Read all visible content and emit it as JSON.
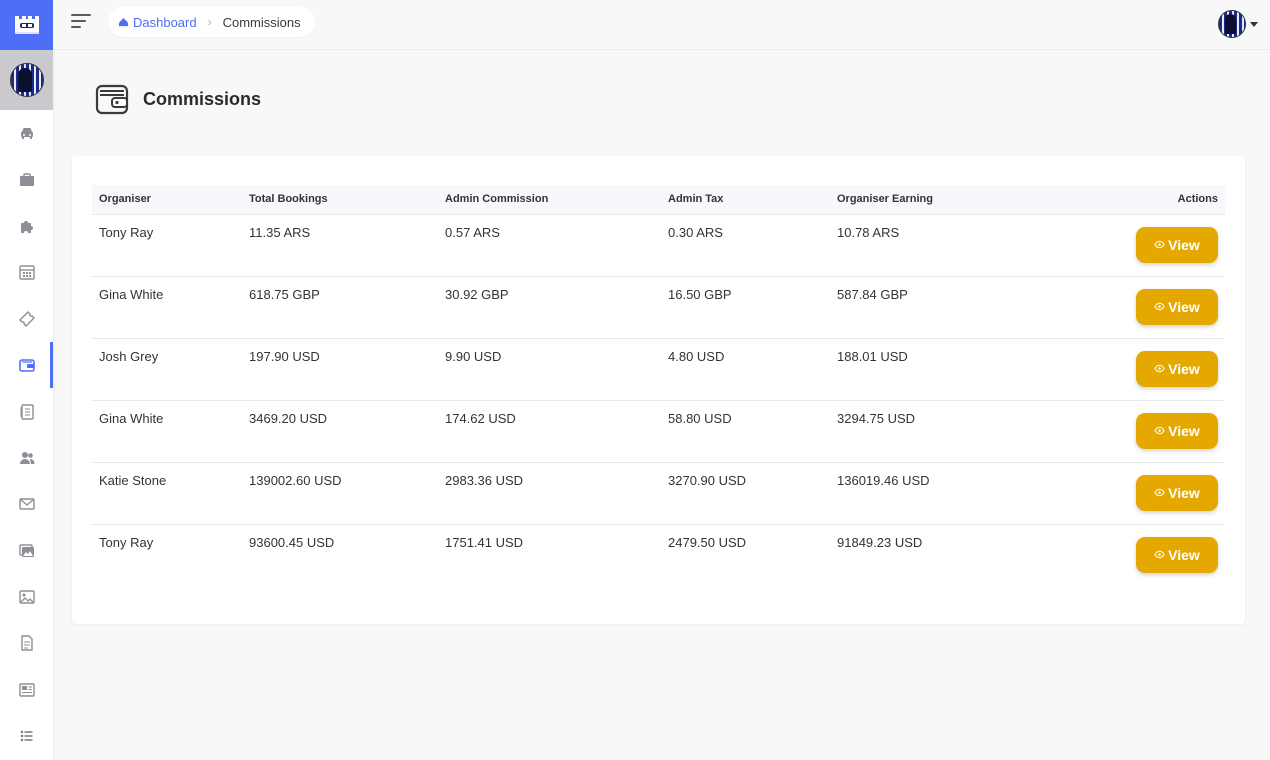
{
  "breadcrumb": {
    "home": "Dashboard",
    "current": "Commissions"
  },
  "page": {
    "title": "Commissions"
  },
  "table": {
    "headers": {
      "organiser": "Organiser",
      "total_bookings": "Total Bookings",
      "admin_commission": "Admin Commission",
      "admin_tax": "Admin Tax",
      "organiser_earning": "Organiser Earning",
      "actions": "Actions"
    },
    "view_label": "View",
    "rows": [
      {
        "organiser": "Tony Ray",
        "total_bookings": "11.35 ARS",
        "admin_commission": "0.57 ARS",
        "admin_tax": "0.30 ARS",
        "organiser_earning": "10.78 ARS"
      },
      {
        "organiser": "Gina White",
        "total_bookings": "618.75 GBP",
        "admin_commission": "30.92 GBP",
        "admin_tax": "16.50 GBP",
        "organiser_earning": "587.84 GBP"
      },
      {
        "organiser": "Josh Grey",
        "total_bookings": "197.90 USD",
        "admin_commission": "9.90 USD",
        "admin_tax": "4.80 USD",
        "organiser_earning": "188.01 USD"
      },
      {
        "organiser": "Gina White",
        "total_bookings": "3469.20 USD",
        "admin_commission": "174.62 USD",
        "admin_tax": "58.80 USD",
        "organiser_earning": "3294.75 USD"
      },
      {
        "organiser": "Katie Stone",
        "total_bookings": "139002.60 USD",
        "admin_commission": "2983.36 USD",
        "admin_tax": "3270.90 USD",
        "organiser_earning": "136019.46 USD"
      },
      {
        "organiser": "Tony Ray",
        "total_bookings": "93600.45 USD",
        "admin_commission": "1751.41 USD",
        "admin_tax": "2479.50 USD",
        "organiser_earning": "91849.23 USD"
      }
    ]
  },
  "sidebar": {
    "icons": [
      "car-icon",
      "briefcase-icon",
      "puzzle-icon",
      "calendar-icon",
      "ticket-icon",
      "wallet-icon",
      "book-icon",
      "users-icon",
      "mail-icon",
      "images-icon",
      "image-icon",
      "document-icon",
      "newspaper-icon",
      "list-icon"
    ],
    "active_index": 5
  },
  "colors": {
    "accent": "#4f6ef7",
    "button": "#e5a800"
  }
}
